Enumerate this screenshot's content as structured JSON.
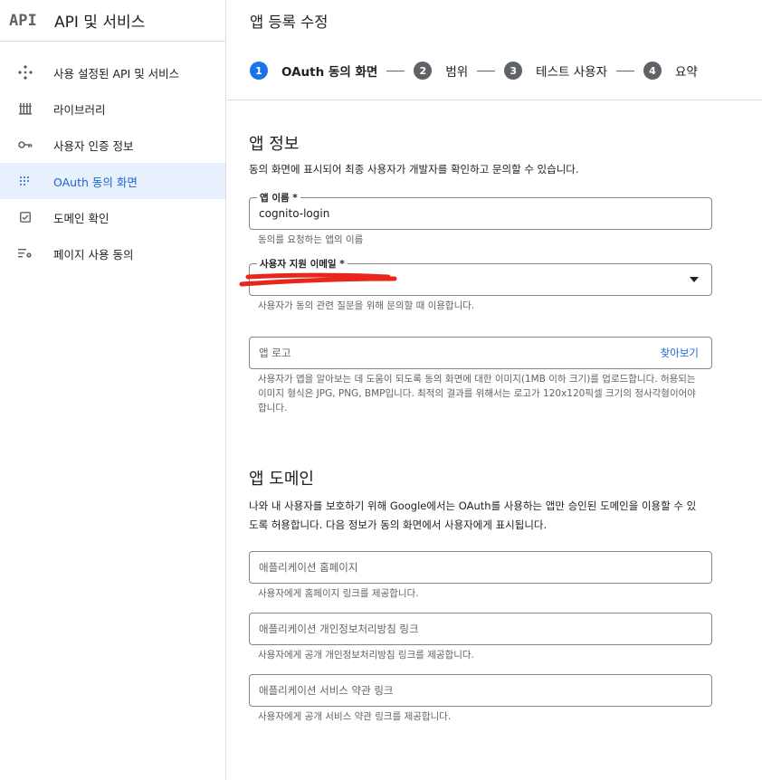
{
  "sidebar": {
    "logo_text": "API",
    "title": "API 및 서비스",
    "items": [
      {
        "label": "사용 설정된 API 및 서비스",
        "icon": "api-diamond-icon"
      },
      {
        "label": "라이브러리",
        "icon": "library-icon"
      },
      {
        "label": "사용자 인증 정보",
        "icon": "key-icon"
      },
      {
        "label": "OAuth 동의 화면",
        "icon": "oauth-dots-icon"
      },
      {
        "label": "도메인 확인",
        "icon": "checkbox-icon"
      },
      {
        "label": "페이지 사용 동의",
        "icon": "settings-list-icon"
      }
    ],
    "active_index": 3
  },
  "main": {
    "title": "앱 등록 수정",
    "steps": [
      {
        "num": "1",
        "label": "OAuth 동의 화면"
      },
      {
        "num": "2",
        "label": "범위"
      },
      {
        "num": "3",
        "label": "테스트 사용자"
      },
      {
        "num": "4",
        "label": "요약"
      }
    ],
    "app_info": {
      "title": "앱 정보",
      "description": "동의 화면에 표시되어 최종 사용자가 개발자를 확인하고 문의할 수 있습니다.",
      "app_name_label": "앱 이름 *",
      "app_name_value": "cognito-login",
      "app_name_hint": "동의를 요청하는 앱의 이름",
      "support_email_label": "사용자 지원 이메일 *",
      "support_email_hint": "사용자가 동의 관련 질문을 위해 문의할 때 이용합니다.",
      "logo_placeholder": "앱 로고",
      "logo_browse": "찾아보기",
      "logo_hint": "사용자가 앱을 알아보는 데 도움이 되도록 동의 화면에 대한 이미지(1MB 이하 크기)를 업로드합니다. 허용되는 이미지 형식은 JPG, PNG, BMP입니다. 최적의 결과를 위해서는 로고가 120x120픽셀 크기의 정사각형이어야 합니다."
    },
    "app_domain": {
      "title": "앱 도메인",
      "description": "나와 내 사용자를 보호하기 위해 Google에서는 OAuth를 사용하는 앱만 승인된 도메인을 이용할 수 있도록 허용합니다. 다음 정보가 동의 화면에서 사용자에게 표시됩니다.",
      "homepage_placeholder": "애플리케이션 홈페이지",
      "homepage_hint": "사용자에게 홈페이지 링크를 제공합니다.",
      "privacy_placeholder": "애플리케이션 개인정보처리방침 링크",
      "privacy_hint": "사용자에게 공개 개인정보처리방침 링크를 제공합니다.",
      "terms_placeholder": "애플리케이션 서비스 약관 링크",
      "terms_hint": "사용자에게 공개 서비스 약관 링크를 제공합니다."
    }
  },
  "colors": {
    "accent": "#1a73e8",
    "active_bg": "#e8f0fe",
    "redaction": "#e8261c",
    "border": "#dadce0"
  }
}
